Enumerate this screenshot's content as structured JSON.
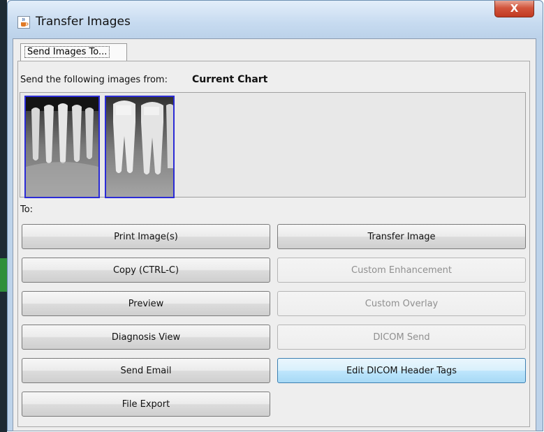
{
  "window": {
    "title": "Transfer Images",
    "close_glyph": "X",
    "icon": "java-cup-icon"
  },
  "tab": {
    "label": "Send Images To..."
  },
  "source": {
    "label": "Send the following images from:",
    "value": "Current Chart"
  },
  "thumbnails": [
    {
      "icon": "xray-anterior-teeth-thumbnail"
    },
    {
      "icon": "xray-molar-teeth-thumbnail"
    }
  ],
  "to_label": "To:",
  "buttons": {
    "print": "Print Image(s)",
    "transfer": "Transfer Image",
    "copy": "Copy (CTRL-C)",
    "custom_enhancement": "Custom Enhancement",
    "preview": "Preview",
    "custom_overlay": "Custom Overlay",
    "diagnosis_view": "Diagnosis View",
    "dicom_send": "DICOM Send",
    "send_email": "Send Email",
    "edit_dicom": "Edit DICOM Header Tags",
    "file_export": "File Export"
  },
  "colors": {
    "selection_border": "#2b2bd6",
    "hover_button": "#bee6fd",
    "close_button": "#c13a22"
  }
}
